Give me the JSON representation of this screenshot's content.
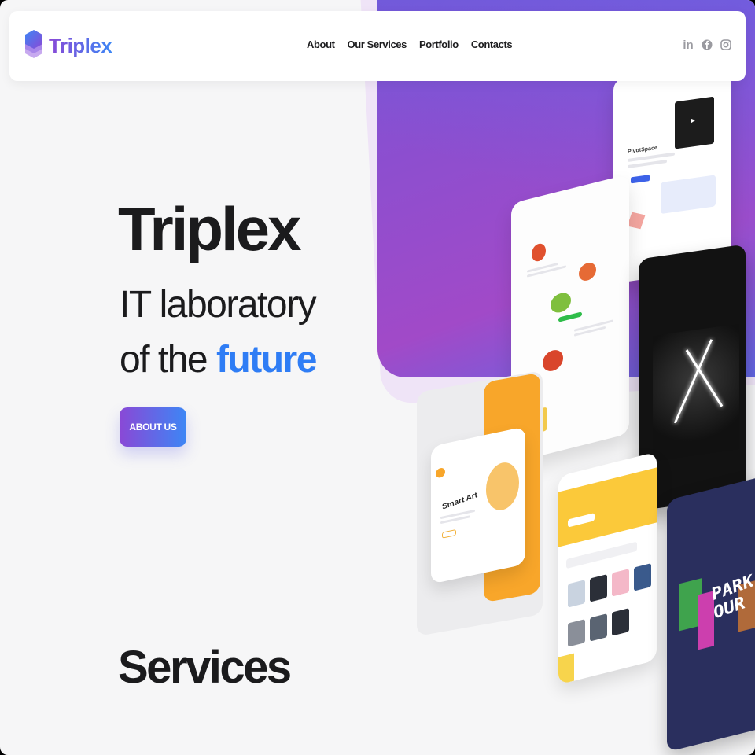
{
  "brand": {
    "name": "Triplex",
    "gradient_start": "#8a48d6",
    "gradient_end": "#3d86f5"
  },
  "nav": {
    "items": [
      {
        "label": "About"
      },
      {
        "label": "Our Services"
      },
      {
        "label": "Portfolio"
      },
      {
        "label": "Contacts"
      }
    ]
  },
  "social": [
    {
      "icon": "linkedin-icon",
      "glyph": "in"
    },
    {
      "icon": "facebook-icon",
      "glyph": "f"
    },
    {
      "icon": "instagram-icon",
      "glyph": "◎"
    }
  ],
  "hero": {
    "title": "Triplex",
    "line1": "IT laboratory",
    "line2_prefix": "of the",
    "line2_highlight": "future",
    "cta": "ABOUT US"
  },
  "sections": {
    "services_title": "Services"
  },
  "mockups": {
    "pivot_label": "PivotSpace",
    "smart_label": "Smart Art",
    "pixel_label": "PARK OUR"
  },
  "colors": {
    "accent_blue": "#2f7df5",
    "text_dark": "#1b1b1d",
    "orange": "#f8a62a"
  }
}
